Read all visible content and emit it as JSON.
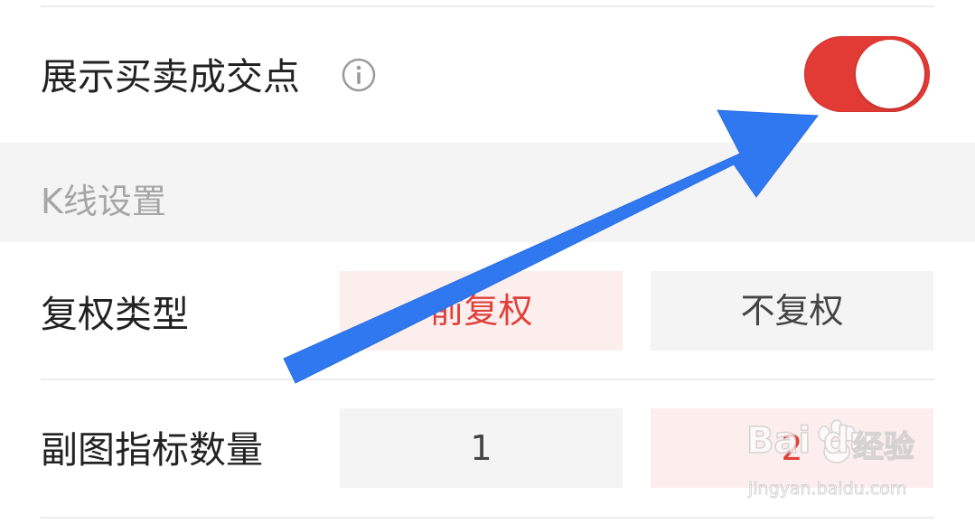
{
  "settings": {
    "show_trade_points": {
      "label": "展示买卖成交点",
      "info_icon": "info-circle-icon",
      "toggle_on": true,
      "toggle_color": "#e23a35"
    },
    "kline_section": {
      "title": "K线设置"
    },
    "adjust_type": {
      "label": "复权类型",
      "options": [
        {
          "label": "前复权",
          "selected": true
        },
        {
          "label": "不复权",
          "selected": false
        }
      ]
    },
    "sub_indicator_count": {
      "label": "副图指标数量",
      "options": [
        {
          "label": "1",
          "selected": false
        },
        {
          "label": "2",
          "selected": true
        }
      ]
    }
  },
  "colors": {
    "accent": "#e23a35",
    "selected_bg": "#fdeeee",
    "option_bg": "#f4f4f4",
    "annotation_arrow": "#2f78f0"
  },
  "overlay": {
    "arrow_icon": "annotation-arrow-icon"
  },
  "watermark": {
    "logo": "Bai du",
    "brand": "经验",
    "url": "jingyan.baidu.com"
  }
}
